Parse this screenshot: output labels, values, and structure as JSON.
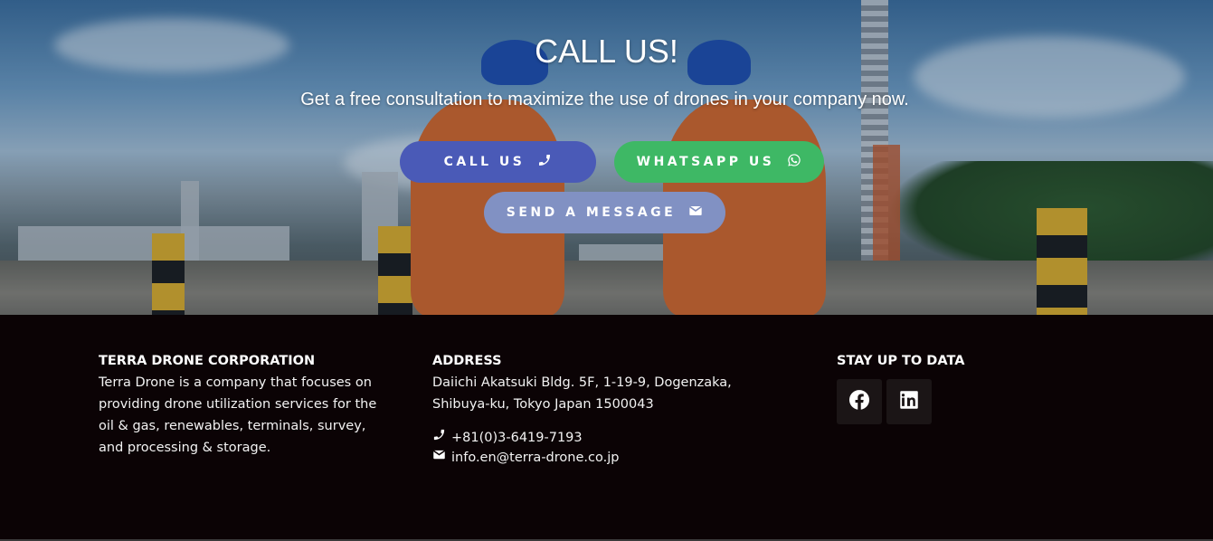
{
  "hero": {
    "title": "CALL US!",
    "subtitle": "Get a free consultation to maximize the use of drones in your company now.",
    "buttons": {
      "call_label": "CALL US",
      "whatsapp_label": "WHATSAPP US",
      "message_label": "SEND A MESSAGE"
    },
    "colors": {
      "call": "#4a5ab7",
      "whatsapp": "#3eb865",
      "message": "#8191c3"
    }
  },
  "footer": {
    "company": {
      "heading": "TERRA DRONE CORPORATION",
      "description": "Terra Drone is a company that focuses on providing drone utilization services for the oil & gas, renewables, terminals, survey, and processing & storage."
    },
    "address": {
      "heading": "ADDRESS",
      "line1": "Daiichi Akatsuki Bldg. 5F, 1-19-9, Dogenzaka,",
      "line2": "Shibuya-ku, Tokyo Japan 1500043",
      "phone": "+81(0)3-6419-7193",
      "email": "info.en@terra-drone.co.jp"
    },
    "social": {
      "heading": "STAY UP TO DATA",
      "icons": [
        "facebook-icon",
        "linkedin-icon"
      ]
    }
  }
}
